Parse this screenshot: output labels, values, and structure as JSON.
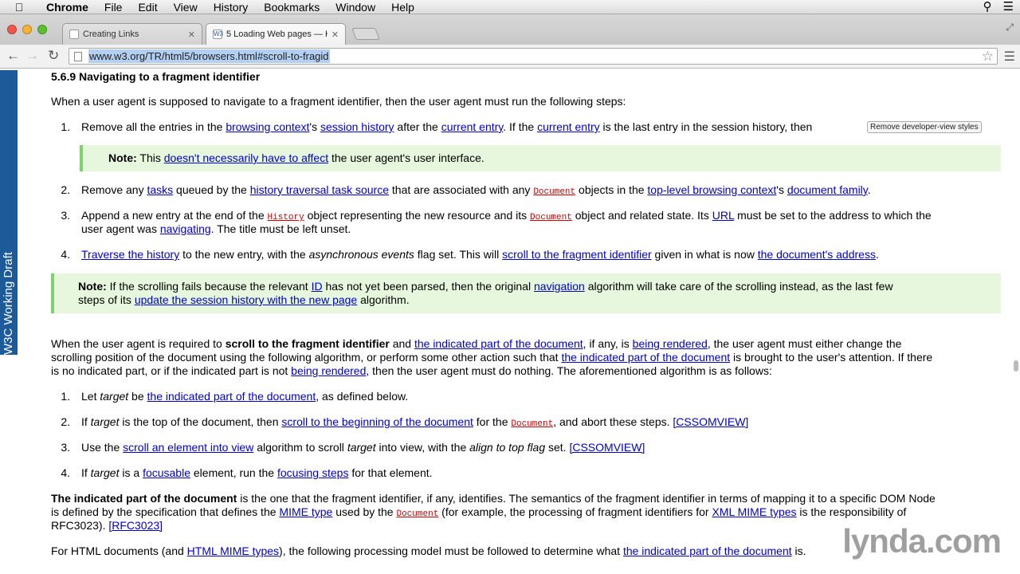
{
  "menubar": {
    "app": "Chrome",
    "items": [
      "File",
      "Edit",
      "View",
      "History",
      "Bookmarks",
      "Window",
      "Help"
    ]
  },
  "tabs": [
    {
      "title": "Creating Links",
      "active": false
    },
    {
      "title": "5 Loading Web pages — H",
      "active": true,
      "favicon": "W3"
    }
  ],
  "toolbar": {
    "url": "www.w3.org/TR/html5/browsers.html#scroll-to-fragid"
  },
  "badge": {
    "text": "W3C Working Draft"
  },
  "remove_dev_btn": "Remove developer-view styles",
  "doc": {
    "heading": "5.6.9 Navigating to a fragment identifier",
    "intro": "When a user agent is supposed to navigate to a fragment identifier, then the user agent must run the following steps:",
    "s1": [
      "1.",
      "Remove all the entries in the ",
      "browsing context",
      "'s ",
      "session history",
      " after the ",
      "current entry",
      ". If the ",
      "current entry",
      " is the last entry in the session history, then"
    ],
    "note1": [
      "Note:",
      " This ",
      "doesn't necessarily have to affect",
      " the user agent's user interface."
    ],
    "s2": [
      "2.",
      "Remove any ",
      "tasks",
      " queued by the ",
      "history traversal task source",
      " that are associated with any ",
      "Document",
      " objects in the ",
      "top-level browsing context",
      "'s ",
      "document family",
      "."
    ],
    "s3a": [
      "3.",
      "Append a new entry at the end of the ",
      "History",
      " object representing the new resource and its ",
      "Document",
      " object and related state. Its ",
      "URL",
      " must be set to the address to which the"
    ],
    "s3b": [
      "user agent was ",
      "navigating",
      ". The title must be left unset."
    ],
    "s4": [
      "4.",
      "Traverse the history",
      " to the new entry, with the ",
      "asynchronous events",
      " flag set. This will ",
      "scroll to the fragment identifier",
      " given in what is now ",
      "the document's address",
      "."
    ],
    "note2a": [
      "Note:",
      " If the scrolling fails because the relevant ",
      "ID",
      " has not yet been parsed, then the original ",
      "navigation",
      " algorithm will take care of the scrolling instead, as the last few"
    ],
    "note2b": [
      "steps of its ",
      "update the session history with the new page",
      " algorithm."
    ],
    "p2a": [
      "When the user agent is required to ",
      "scroll to the fragment identifier",
      " and ",
      "the indicated part of the document",
      ", if any, is ",
      "being rendered",
      ", the user agent must either change the"
    ],
    "p2b": [
      "scrolling position of the document using the following algorithm, or perform some other action such that ",
      "the indicated part of the document",
      " is brought to the user's attention. If there"
    ],
    "p2c": [
      "is no indicated part, or if the indicated part is not ",
      "being rendered",
      ", then the user agent must do nothing. The aforementioned algorithm is as follows:"
    ],
    "t1": [
      "1.",
      "Let ",
      "target",
      " be ",
      "the indicated part of the document",
      ", as defined below."
    ],
    "t2": [
      "2.",
      "If ",
      "target",
      " is the top of the document, then ",
      "scroll to the beginning of the document",
      " for the ",
      "Document",
      ", and abort these steps. ",
      "[CSSOMVIEW]"
    ],
    "t3": [
      "3.",
      "Use the ",
      "scroll an element into view",
      " algorithm to scroll ",
      "target",
      " into view, with the ",
      "align to top flag",
      " set. ",
      "[CSSOMVIEW]"
    ],
    "t4": [
      "4.",
      "If ",
      "target",
      " is a ",
      "focusable",
      " element, run the ",
      "focusing steps",
      " for that element."
    ],
    "p3a": [
      "The indicated part of the document",
      " is the one that the fragment identifier, if any, identifies. The semantics of the fragment identifier in terms of mapping it to a specific DOM Node"
    ],
    "p3b": [
      "is defined by the specification that defines the ",
      "MIME type",
      " used by the ",
      "Document",
      " (for example, the processing of fragment identifiers for ",
      "XML MIME types",
      " is the responsibility of"
    ],
    "p3c": [
      "RFC3023). ",
      "[RFC3023]"
    ],
    "p4": [
      "For HTML documents (and ",
      "HTML MIME types",
      "), the following processing model must be followed to determine what ",
      "the indicated part of the document",
      " is."
    ]
  },
  "watermark": "lynda.com"
}
